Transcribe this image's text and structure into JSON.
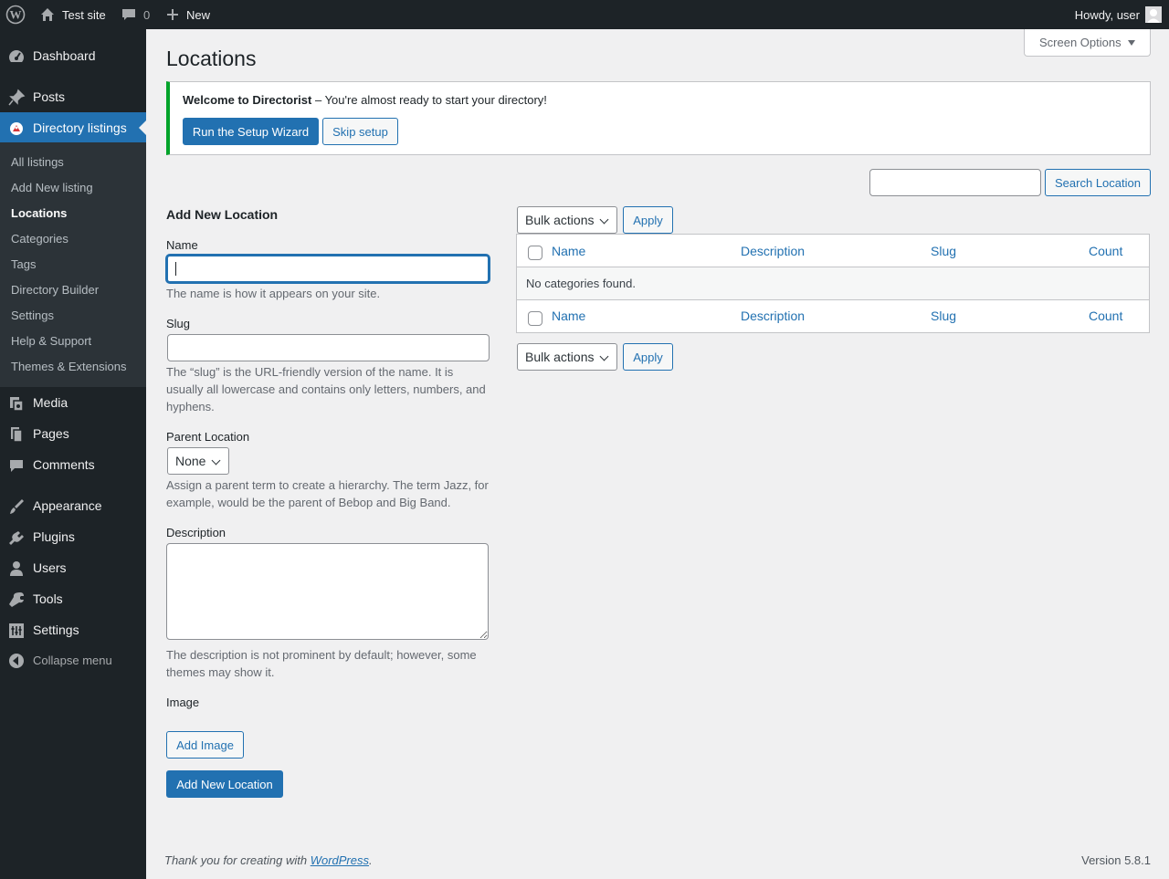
{
  "adminbar": {
    "site_name": "Test site",
    "comments_count": "0",
    "new_label": "New",
    "howdy": "Howdy, user"
  },
  "sidebar": {
    "items": [
      {
        "label": "Dashboard",
        "icon": "dashboard-icon"
      },
      {
        "label": "Posts",
        "icon": "pin-icon"
      },
      {
        "label": "Directory listings",
        "icon": "directory-icon"
      },
      {
        "label": "Media",
        "icon": "media-icon"
      },
      {
        "label": "Pages",
        "icon": "pages-icon"
      },
      {
        "label": "Comments",
        "icon": "comments-icon"
      },
      {
        "label": "Appearance",
        "icon": "brush-icon"
      },
      {
        "label": "Plugins",
        "icon": "plug-icon"
      },
      {
        "label": "Users",
        "icon": "user-icon"
      },
      {
        "label": "Tools",
        "icon": "wrench-icon"
      },
      {
        "label": "Settings",
        "icon": "settings-icon"
      },
      {
        "label": "Collapse menu",
        "icon": "collapse-icon"
      }
    ],
    "submenu": [
      "All listings",
      "Add New listing",
      "Locations",
      "Categories",
      "Tags",
      "Directory Builder",
      "Settings",
      "Help & Support",
      "Themes & Extensions"
    ]
  },
  "screen_options": "Screen Options",
  "page_title": "Locations",
  "notice": {
    "strong": "Welcome to Directorist",
    "text": " – You're almost ready to start your directory!",
    "run_wizard": "Run the Setup Wizard",
    "skip": "Skip setup"
  },
  "search": {
    "value": "",
    "button": "Search Location"
  },
  "form": {
    "heading": "Add New Location",
    "name_label": "Name",
    "name_value": "",
    "name_help": "The name is how it appears on your site.",
    "slug_label": "Slug",
    "slug_value": "",
    "slug_help": "The “slug” is the URL-friendly version of the name. It is usually all lowercase and contains only letters, numbers, and hyphens.",
    "parent_label": "Parent Location",
    "parent_value": "None",
    "parent_help": "Assign a parent term to create a hierarchy. The term Jazz, for example, would be the parent of Bebop and Big Band.",
    "description_label": "Description",
    "description_value": "",
    "description_help": "The description is not prominent by default; however, some themes may show it.",
    "image_label": "Image",
    "add_image": "Add Image",
    "submit": "Add New Location"
  },
  "table": {
    "bulk_actions": "Bulk actions",
    "apply": "Apply",
    "columns": [
      "Name",
      "Description",
      "Slug",
      "Count"
    ],
    "empty": "No categories found."
  },
  "footer": {
    "thanks_prefix": "Thank you for creating with ",
    "thanks_link": "WordPress",
    "thanks_suffix": ".",
    "version": "Version 5.8.1"
  },
  "colors": {
    "adminbar": "#1d2327",
    "accent": "#2271b1",
    "notice_success": "#00a32a",
    "background": "#f0f0f1"
  }
}
